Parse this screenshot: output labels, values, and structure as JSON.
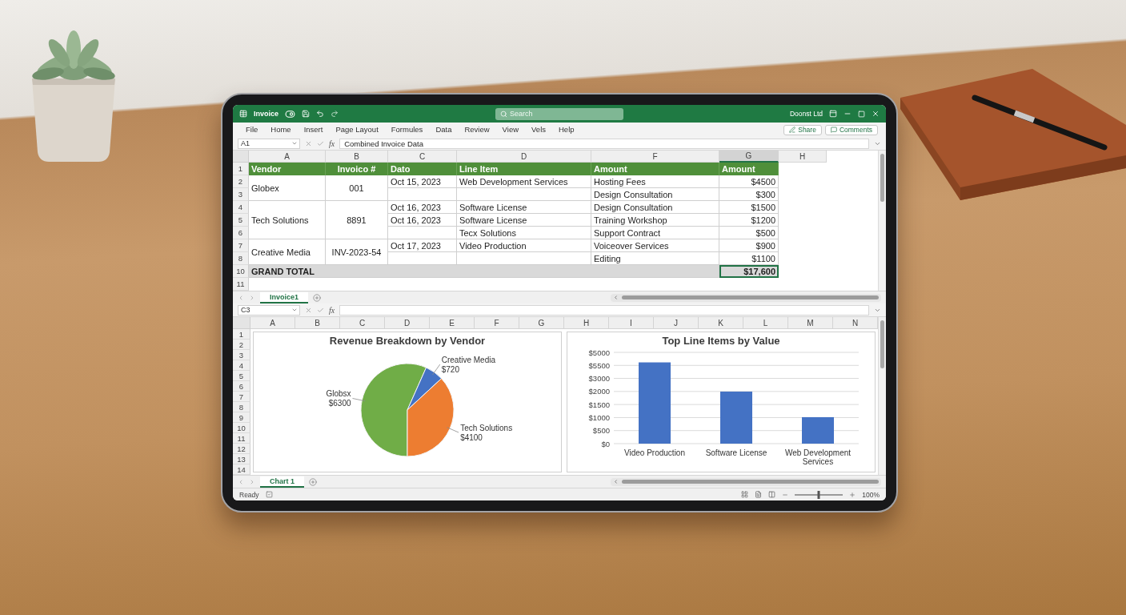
{
  "title_bar": {
    "title": "Invoice",
    "search": {
      "placeholder": "Search"
    },
    "account": "Doonst Ltd"
  },
  "ribbon": {
    "tabs": [
      {
        "label": "File",
        "selected": false
      },
      {
        "label": "Home",
        "selected": false
      },
      {
        "label": "Insert",
        "selected": false
      },
      {
        "label": "Page Layout",
        "selected": false
      },
      {
        "label": "Formules",
        "selected": false
      },
      {
        "label": "Data",
        "selected": false
      },
      {
        "label": "Review",
        "selected": false
      },
      {
        "label": "View",
        "selected": false
      },
      {
        "label": "Vels",
        "selected": false
      },
      {
        "label": "Help",
        "selected": false
      }
    ],
    "share": "Share",
    "comments": "Comments"
  },
  "formula_bar": {
    "name_box": "A1",
    "function_label": "fx",
    "value": "Combined Invoice Data"
  },
  "sheet": {
    "columns": [
      {
        "label": "A",
        "selected": false
      },
      {
        "label": "B",
        "selected": false
      },
      {
        "label": "C",
        "selected": false
      },
      {
        "label": "D",
        "selected": false
      },
      {
        "label": "F",
        "selected": false
      },
      {
        "label": "G",
        "selected": true
      },
      {
        "label": "H",
        "selected": false
      }
    ],
    "header": {
      "row": "1",
      "cells": [
        "Vendor",
        "Invoico #",
        "Dato",
        "Line Item",
        "Amount",
        "Amount"
      ]
    },
    "groups": [
      {
        "vendor": "Globex",
        "invoice": "001",
        "lines": [
          {
            "row": "2",
            "date": "Oct 15, 2023",
            "line_item": "Web Development Services",
            "description": "Hosting Fees",
            "amount": "$4500"
          },
          {
            "row": "3",
            "description": "Design Consultation",
            "amount": "$300"
          }
        ]
      },
      {
        "vendor": "Tech Solutions",
        "invoice": "8891",
        "lines": [
          {
            "row": "4",
            "date": "Oct 16, 2023",
            "line_item": "Software License",
            "description": "Design Consultation",
            "amount": "$1500"
          },
          {
            "row": "5",
            "date": "Oct 16, 2023",
            "line_item": "Software License",
            "description": "Training Workshop",
            "amount": "$1200"
          },
          {
            "row": "6",
            "line_item": "Tecx Solutions",
            "description": "Support Contract",
            "amount": "$500"
          }
        ]
      },
      {
        "vendor": "Creative Media",
        "invoice": "INV-2023-54",
        "lines": [
          {
            "row": "7",
            "date": "Oct 17, 2023",
            "line_item": "Video Production",
            "description": "Voiceover Services",
            "amount": "$900"
          },
          {
            "row": "8",
            "description": "Editing",
            "amount": "$1100"
          }
        ]
      }
    ],
    "total": {
      "row": "10",
      "label": "GRAND TOTAL",
      "value": "$17,600",
      "selected": true
    },
    "extra_rows": [
      "11"
    ]
  },
  "sheet_tabs": [
    {
      "label": "Invoice1",
      "selected": true
    }
  ],
  "chart_sheet": {
    "formula_bar": {
      "name_box": "C3",
      "function_label": "fx"
    },
    "columns": [
      "A",
      "B",
      "C",
      "D",
      "E",
      "F",
      "G",
      "H",
      "I",
      "J",
      "K",
      "L",
      "M",
      "N"
    ],
    "rows": [
      "1",
      "2",
      "3",
      "4",
      "5",
      "6",
      "7",
      "8",
      "9",
      "10",
      "11",
      "12",
      "13",
      "14"
    ],
    "pie_chart": {
      "chart_data": {
        "type": "pie",
        "title": "Revenue Breakdown by Vendor",
        "categories": [
          "Globsx",
          "Creative Media",
          "Tech Solutions"
        ],
        "values": [
          6300,
          720,
          4100
        ],
        "value_labels": [
          "$6300",
          "$720",
          "$4100"
        ]
      }
    },
    "bar_chart": {
      "title": "Top Line Items by Value",
      "y_axis_labels": [
        "$5000",
        "$5500",
        "$3000",
        "$2000",
        "$1500",
        "$1000",
        "$500",
        "$0"
      ],
      "categories": [
        "Video Production",
        "Software License",
        "Web Development Services"
      ]
    }
  },
  "chart_tabs": [
    {
      "label": "Chart 1",
      "selected": true
    }
  ],
  "status_bar": {
    "status": "Ready",
    "zoom": {
      "level": 0.5,
      "label": "100%"
    }
  }
}
